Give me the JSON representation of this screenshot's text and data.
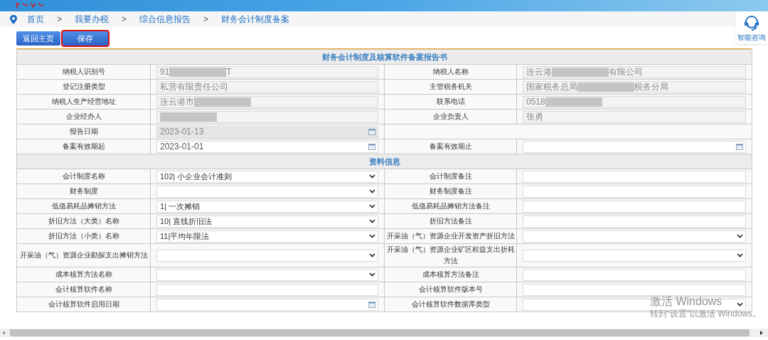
{
  "breadcrumb": {
    "items": [
      "首页",
      "我要办税",
      "综合信息报告",
      "财务会计制度备案"
    ],
    "separator": ">"
  },
  "buttons": [
    {
      "label": "返回主页",
      "highlighted": false
    },
    {
      "label": "保存",
      "highlighted": true
    }
  ],
  "help_widget": {
    "label": "智能咨询"
  },
  "form": {
    "title": "财务会计制度及核算软件备案报告书",
    "basic_rows": [
      {
        "cells": [
          {
            "label": "纳税人识别号",
            "field": {
              "kind": "text",
              "readonly": true,
              "segments": [
                {
                  "kind": "text",
                  "text": "91"
                },
                {
                  "kind": "redacted"
                },
                {
                  "kind": "text",
                  "text": "T"
                }
              ]
            }
          },
          {
            "label": "纳税人名称",
            "field": {
              "kind": "text",
              "readonly": true,
              "segments": [
                {
                  "kind": "text",
                  "text": "连云港"
                },
                {
                  "kind": "redacted"
                },
                {
                  "kind": "text",
                  "text": "有限公司"
                }
              ]
            }
          }
        ]
      },
      {
        "cells": [
          {
            "label": "登记注册类型",
            "field": {
              "kind": "text",
              "readonly": true,
              "value": "私营有限责任公司"
            }
          },
          {
            "label": "主管税务机关",
            "field": {
              "kind": "text",
              "readonly": true,
              "segments": [
                {
                  "kind": "text",
                  "text": "国家税务总局"
                },
                {
                  "kind": "redacted"
                },
                {
                  "kind": "text",
                  "text": "税务分局"
                }
              ]
            }
          }
        ]
      },
      {
        "cells": [
          {
            "label": "纳税人生产经营地址",
            "field": {
              "kind": "text",
              "readonly": true,
              "segments": [
                {
                  "kind": "text",
                  "text": "连云港市"
                },
                {
                  "kind": "redacted"
                }
              ]
            }
          },
          {
            "label": "联系电话",
            "field": {
              "kind": "text",
              "readonly": true,
              "segments": [
                {
                  "kind": "text",
                  "text": "0518"
                },
                {
                  "kind": "redacted"
                }
              ]
            }
          }
        ]
      },
      {
        "cells": [
          {
            "label": "企业经办人",
            "field": {
              "kind": "text",
              "readonly": true,
              "segments": [
                {
                  "kind": "redacted"
                }
              ]
            }
          },
          {
            "label": "企业负责人",
            "field": {
              "kind": "text",
              "readonly": true,
              "value": "张勇"
            }
          }
        ]
      },
      {
        "cells": [
          {
            "label": "报告日期",
            "field": {
              "kind": "date",
              "readonly": true,
              "value": "2023-01-13"
            }
          }
        ]
      },
      {
        "cells": [
          {
            "label": "备案有效期起",
            "field": {
              "kind": "date",
              "readonly": false,
              "value": "2023-01-01"
            }
          },
          {
            "label": "备案有效期止",
            "field": {
              "kind": "date",
              "readonly": false
            }
          }
        ]
      }
    ],
    "section_title": "资料信息",
    "detail_rows": [
      {
        "cells": [
          {
            "label": "会计制度名称",
            "field": {
              "kind": "select",
              "readonly": false,
              "value": "102| 小企业会计准则"
            }
          },
          {
            "label": "会计制度备注",
            "field": {
              "kind": "text",
              "readonly": false
            }
          }
        ]
      },
      {
        "cells": [
          {
            "label": "财务制度",
            "field": {
              "kind": "select",
              "readonly": false
            }
          },
          {
            "label": "财务制度备注",
            "field": {
              "kind": "text",
              "readonly": false
            }
          }
        ]
      },
      {
        "cells": [
          {
            "label": "低值易耗品摊销方法",
            "field": {
              "kind": "select",
              "readonly": false,
              "value": "1| 一次摊销"
            }
          },
          {
            "label": "低值易耗品摊销方法备注",
            "field": {
              "kind": "text",
              "readonly": false
            }
          }
        ]
      },
      {
        "cells": [
          {
            "label": "折旧方法（大类）名称",
            "field": {
              "kind": "select",
              "readonly": false,
              "value": "10| 直线折旧法"
            }
          },
          {
            "label": "折旧方法备注",
            "field": {
              "kind": "text",
              "readonly": false
            }
          }
        ]
      },
      {
        "cells": [
          {
            "label": "折旧方法（小类）名称",
            "field": {
              "kind": "select",
              "readonly": false,
              "value": "11|平均年限法"
            }
          },
          {
            "label": "开采油（气）资源企业开发资产折旧方法",
            "field": {
              "kind": "select",
              "readonly": false
            }
          }
        ]
      },
      {
        "cells": [
          {
            "label": "开采油（气）资源企业勘探支出摊销方法",
            "field": {
              "kind": "select",
              "readonly": false
            }
          },
          {
            "label": "开采油（气）资源企业矿区权益支出折耗方法",
            "field": {
              "kind": "select",
              "readonly": false
            }
          }
        ]
      },
      {
        "cells": [
          {
            "label": "成本核算方法名称",
            "field": {
              "kind": "select",
              "readonly": false
            }
          },
          {
            "label": "成本核算方法备注",
            "field": {
              "kind": "text",
              "readonly": false
            }
          }
        ]
      },
      {
        "cells": [
          {
            "label": "会计核算软件名称",
            "field": {
              "kind": "text",
              "readonly": false
            }
          },
          {
            "label": "会计核算软件版本号",
            "field": {
              "kind": "text",
              "readonly": false
            }
          }
        ]
      },
      {
        "cells": [
          {
            "label": "会计核算软件启用日期",
            "field": {
              "kind": "date",
              "readonly": false
            }
          },
          {
            "label": "会计核算软件数据库类型",
            "field": {
              "kind": "select",
              "readonly": false
            }
          }
        ]
      }
    ]
  },
  "os_notice": {
    "title": "激活 Windows",
    "text": "转到“设置”以激活 Windows。"
  }
}
